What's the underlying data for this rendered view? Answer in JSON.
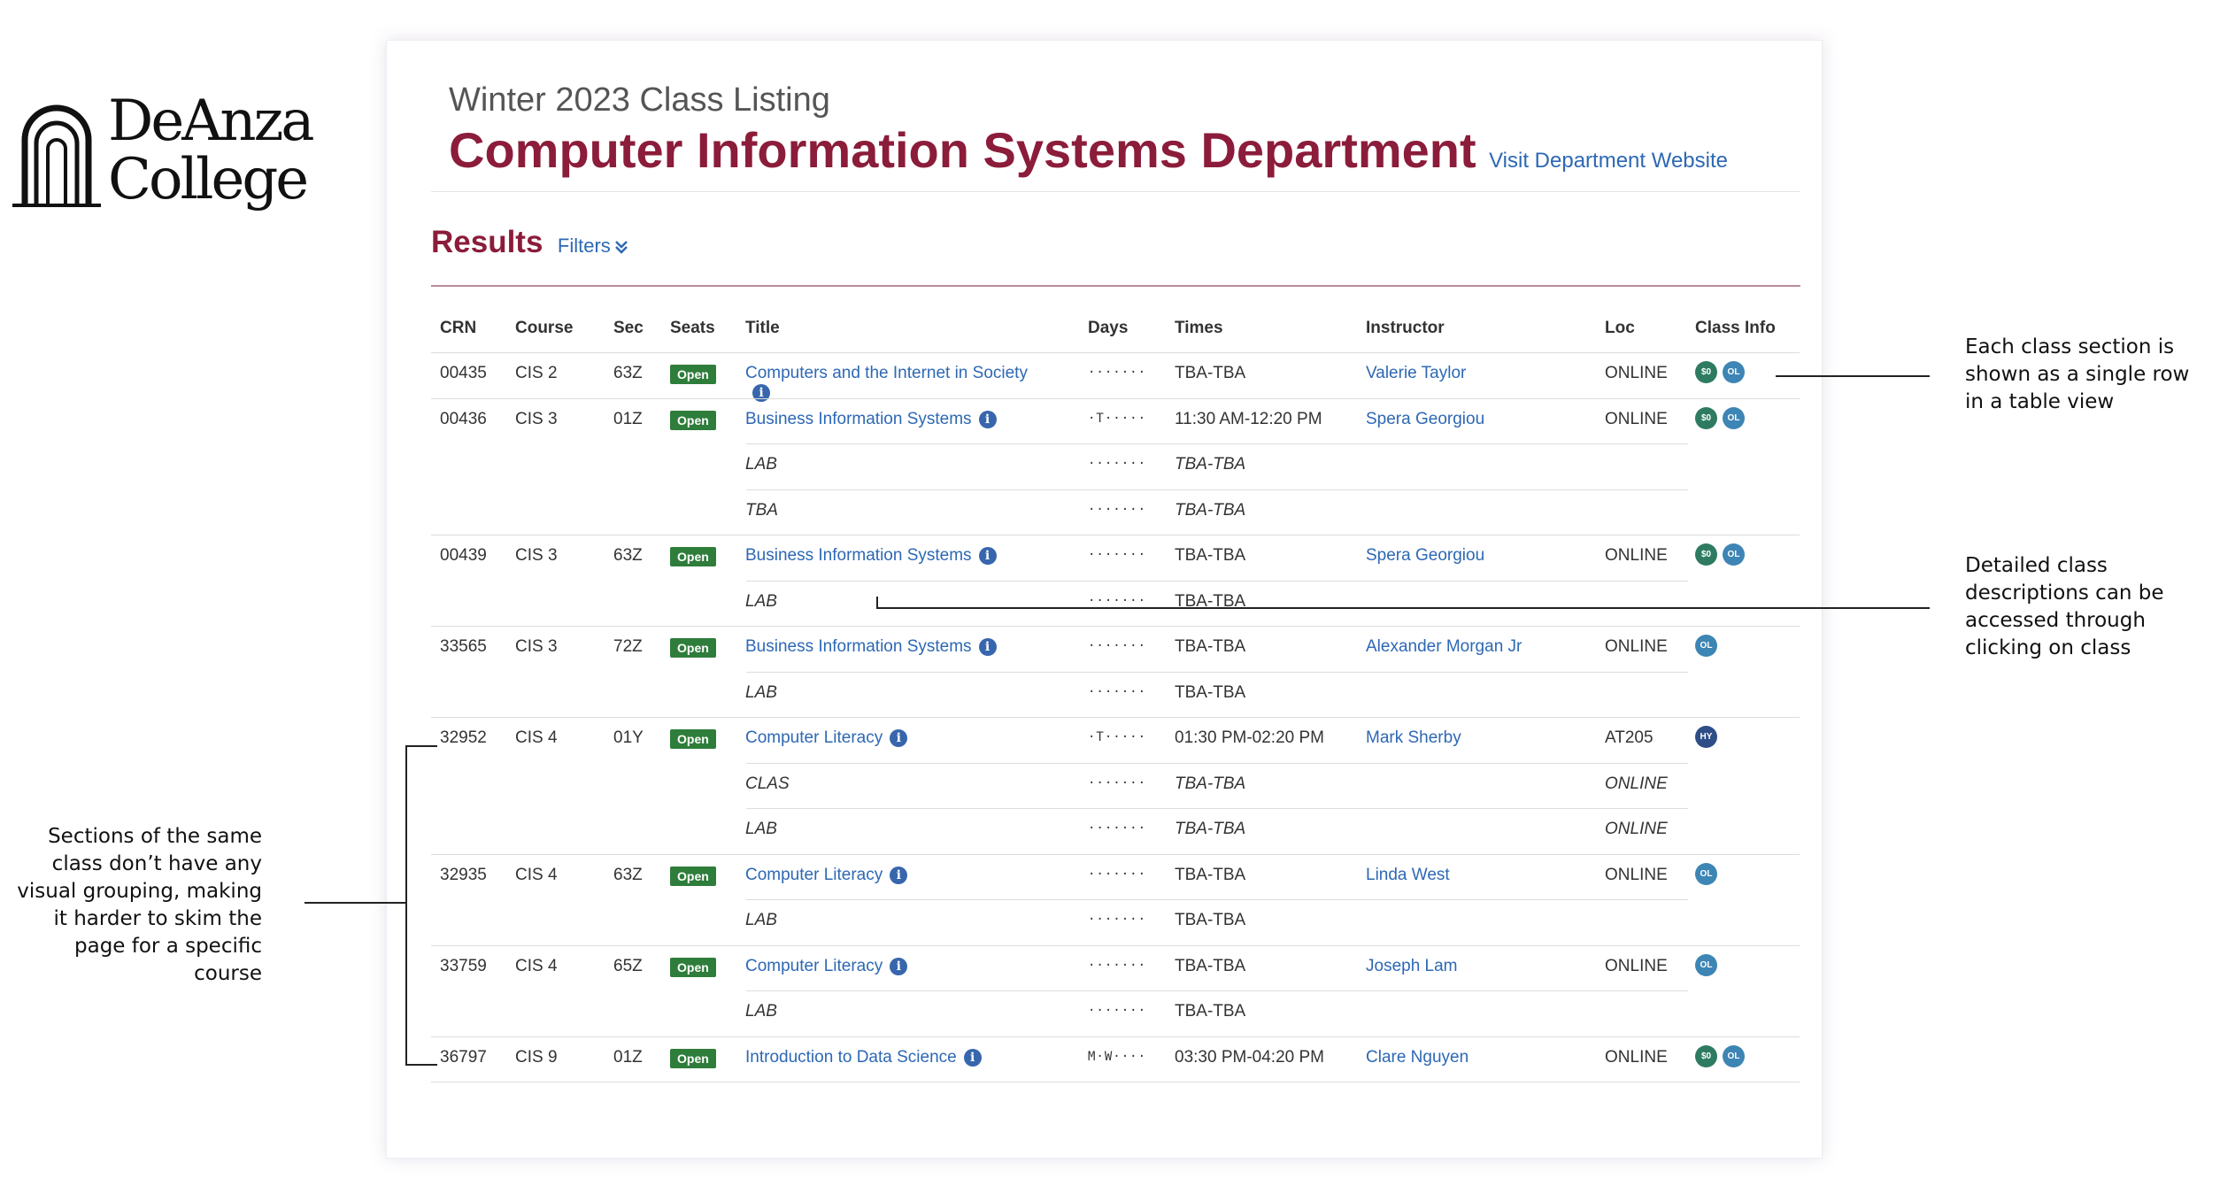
{
  "logo": {
    "line1": "DeAnza",
    "line2": "College"
  },
  "header": {
    "subtitle": "Winter 2023 Class Listing",
    "department": "Computer Information Systems Department",
    "dept_link": "Visit Department Website"
  },
  "results": {
    "title": "Results",
    "filters_label": "Filters"
  },
  "table": {
    "headers": [
      "CRN",
      "Course",
      "Sec",
      "Seats",
      "Title",
      "Days",
      "Times",
      "Instructor",
      "Loc",
      "Class Info"
    ],
    "rows": [
      {
        "crn": "00435",
        "course": "CIS 2",
        "sec": "63Z",
        "seats": "Open",
        "title": "Computers and the Internet in Society",
        "days": "·······",
        "times": "TBA-TBA",
        "instructor": "Valerie Taylor",
        "loc": "ONLINE",
        "info": [
          "$0",
          "OL"
        ]
      },
      {
        "crn": "00436",
        "course": "CIS 3",
        "sec": "01Z",
        "seats": "Open",
        "title": "Business Information Systems",
        "days": "·T·····",
        "times": "11:30 AM-12:20 PM",
        "instructor": "Spera Georgiou",
        "loc": "ONLINE",
        "info": [
          "$0",
          "OL"
        ]
      },
      {
        "sub": "LAB",
        "days": "·······",
        "times": "TBA-TBA",
        "loc": ""
      },
      {
        "sub": "TBA",
        "days": "·······",
        "times": "TBA-TBA",
        "loc": ""
      },
      {
        "crn": "00439",
        "course": "CIS 3",
        "sec": "63Z",
        "seats": "Open",
        "title": "Business Information Systems",
        "days": "·······",
        "times": "TBA-TBA",
        "instructor": "Spera Georgiou",
        "loc": "ONLINE",
        "info": [
          "$0",
          "OL"
        ]
      },
      {
        "sub": "LAB",
        "days": "·······",
        "times": "TBA-TBA",
        "loc": ""
      },
      {
        "crn": "33565",
        "course": "CIS 3",
        "sec": "72Z",
        "seats": "Open",
        "title": "Business Information Systems",
        "days": "·······",
        "times": "TBA-TBA",
        "instructor": "Alexander Morgan Jr",
        "loc": "ONLINE",
        "info": [
          "OL"
        ]
      },
      {
        "sub": "LAB",
        "days": "·······",
        "times": "TBA-TBA",
        "loc": ""
      },
      {
        "crn": "32952",
        "course": "CIS 4",
        "sec": "01Y",
        "seats": "Open",
        "title": "Computer Literacy",
        "days": "·T·····",
        "times": "01:30 PM-02:20 PM",
        "instructor": "Mark Sherby",
        "loc": "AT205",
        "info": [
          "HY"
        ]
      },
      {
        "sub": "CLAS",
        "days": "·······",
        "times": "TBA-TBA",
        "loc": "ONLINE"
      },
      {
        "sub": "LAB",
        "days": "·······",
        "times": "TBA-TBA",
        "loc": "ONLINE"
      },
      {
        "crn": "32935",
        "course": "CIS 4",
        "sec": "63Z",
        "seats": "Open",
        "title": "Computer Literacy",
        "days": "·······",
        "times": "TBA-TBA",
        "instructor": "Linda West",
        "loc": "ONLINE",
        "info": [
          "OL"
        ]
      },
      {
        "sub": "LAB",
        "days": "·······",
        "times": "TBA-TBA",
        "loc": ""
      },
      {
        "crn": "33759",
        "course": "CIS 4",
        "sec": "65Z",
        "seats": "Open",
        "title": "Computer Literacy",
        "days": "·······",
        "times": "TBA-TBA",
        "instructor": "Joseph Lam",
        "loc": "ONLINE",
        "info": [
          "OL"
        ]
      },
      {
        "sub": "LAB",
        "days": "·······",
        "times": "TBA-TBA",
        "loc": ""
      },
      {
        "crn": "36797",
        "course": "CIS 9",
        "sec": "01Z",
        "seats": "Open",
        "title": "Introduction to Data Science",
        "days": "M·W····",
        "times": "03:30 PM-04:20 PM",
        "instructor": "Clare Nguyen",
        "loc": "ONLINE",
        "info": [
          "$0",
          "OL"
        ]
      }
    ]
  },
  "annotations": {
    "row_note": "Each class section is shown as a single row in a table view",
    "desc_note": "Detailed class descriptions can be accessed through clicking on class",
    "group_note": "Sections of the same class don’t have any visual grouping, making it harder to skim the page for a specific course"
  },
  "colors": {
    "brand": "#8b1c3a",
    "link": "#2d68b4",
    "open": "#2f7d3b"
  }
}
